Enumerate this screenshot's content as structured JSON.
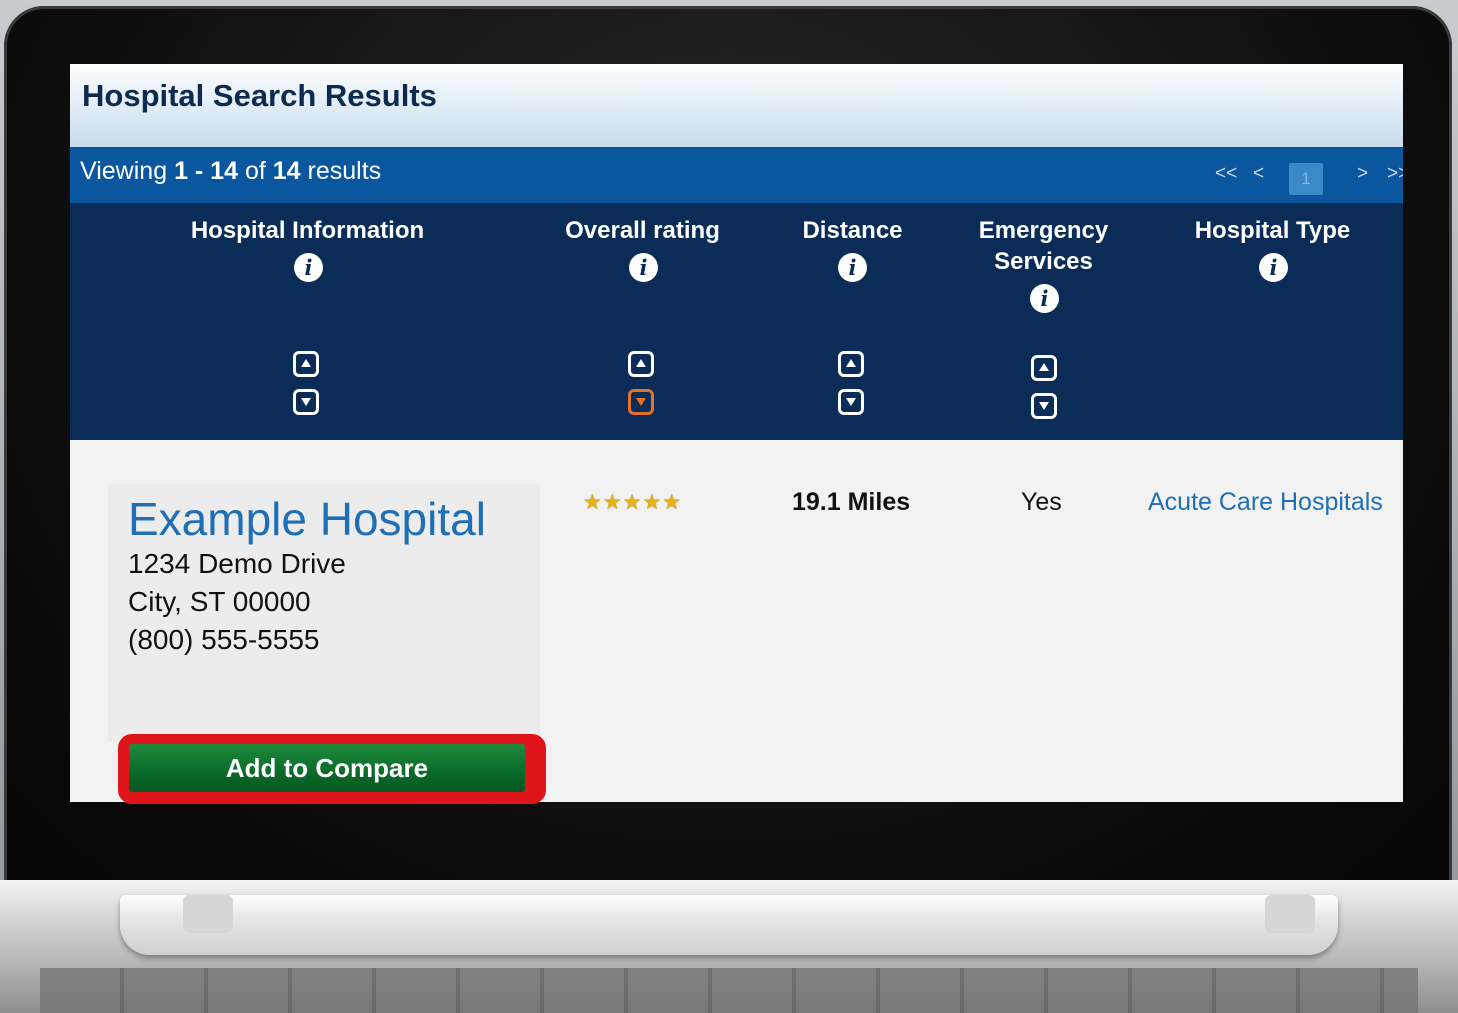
{
  "page": {
    "title": "Hospital Search Results"
  },
  "viewing": {
    "prefix": "Viewing",
    "range": "1 - 14",
    "of": "of",
    "total": "14",
    "suffix": "results"
  },
  "pager": {
    "first": "<<",
    "prev": "<",
    "current": "1",
    "next": ">",
    "last": ">>"
  },
  "columns": [
    {
      "label": "Hospital Information",
      "info_icon": "info-icon",
      "sortable": true
    },
    {
      "label": "Overall rating",
      "info_icon": "info-icon",
      "sortable": true,
      "active_sort": "down"
    },
    {
      "label": "Distance",
      "info_icon": "info-icon",
      "sortable": true
    },
    {
      "label_line1": "Emergency",
      "label_line2": "Services",
      "info_icon": "info-icon",
      "sortable": true
    },
    {
      "label": "Hospital Type",
      "info_icon": "info-icon",
      "sortable": false
    }
  ],
  "info_glyph": "i",
  "result": {
    "name": "Example Hospital",
    "address_line1": "1234 Demo Drive",
    "address_line2": "City, ST 00000",
    "phone": "(800) 555-5555",
    "rating_stars": 5,
    "rating_glyphs": "★★★★★",
    "distance": "19.1 Miles",
    "emergency": "Yes",
    "type": "Acute Care Hospitals",
    "compare_label": "Add to Compare"
  },
  "colors": {
    "title_text": "#0d2a4f",
    "viewing_bar": "#0a57a0",
    "header_bg": "#0b2c56",
    "link": "#1f6fb6",
    "compare_button": "#0a6a2a",
    "highlight_border": "#e0141b",
    "active_sort": "#e8712a"
  }
}
